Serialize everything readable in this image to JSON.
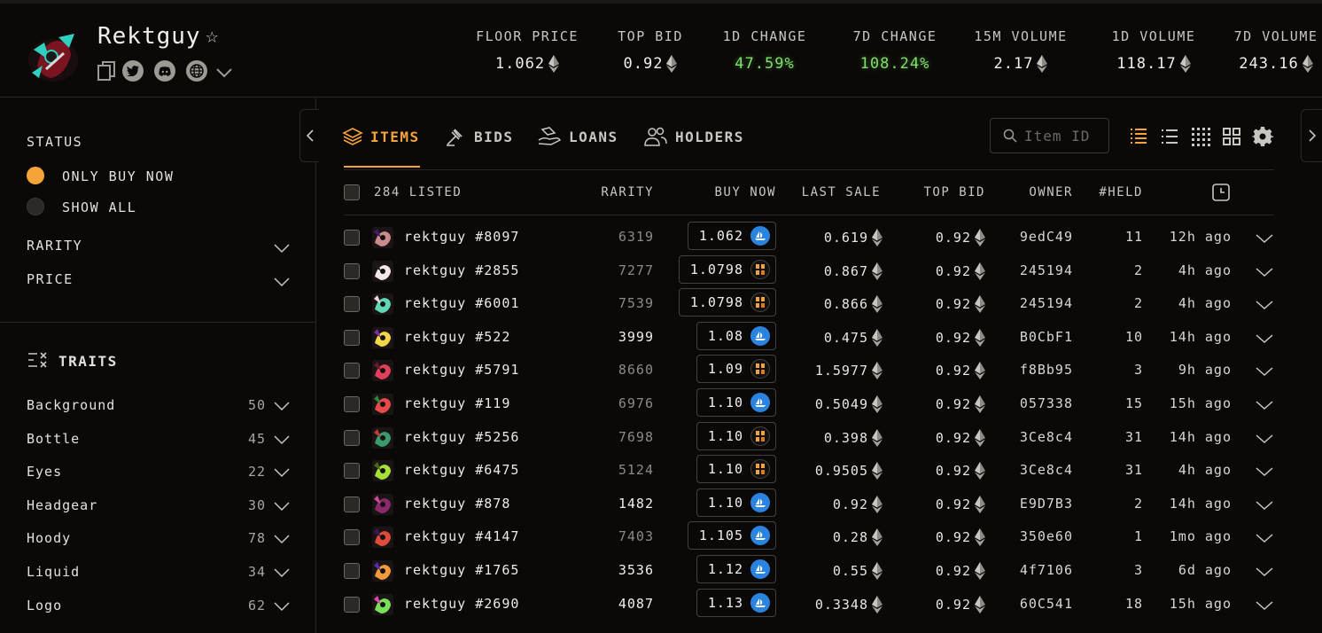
{
  "header": {
    "collection_name": "Rektguy",
    "stats": [
      {
        "label": "FLOOR PRICE",
        "value": "1.062",
        "eth": true,
        "green": false
      },
      {
        "label": "TOP BID",
        "value": "0.92",
        "eth": true,
        "green": false
      },
      {
        "label": "1D CHANGE",
        "value": "47.59%",
        "eth": false,
        "green": true
      },
      {
        "label": "7D CHANGE",
        "value": "108.24%",
        "eth": false,
        "green": true
      },
      {
        "label": "15M VOLUME",
        "value": "2.17",
        "eth": true,
        "green": false
      },
      {
        "label": "1D VOLUME",
        "value": "118.17",
        "eth": true,
        "green": false
      },
      {
        "label": "7D VOLUME",
        "value": "243.16",
        "eth": true,
        "green": false
      }
    ]
  },
  "sidebar": {
    "status_label": "STATUS",
    "only_buy_now": "ONLY BUY NOW",
    "show_all": "SHOW ALL",
    "rarity_label": "RARITY",
    "price_label": "PRICE",
    "traits_label": "TRAITS",
    "traits": [
      {
        "name": "Background",
        "count": "50"
      },
      {
        "name": "Bottle",
        "count": "45"
      },
      {
        "name": "Eyes",
        "count": "22"
      },
      {
        "name": "Headgear",
        "count": "30"
      },
      {
        "name": "Hoody",
        "count": "78"
      },
      {
        "name": "Liquid",
        "count": "34"
      },
      {
        "name": "Logo",
        "count": "62"
      }
    ]
  },
  "tabs": {
    "items": "ITEMS",
    "bids": "BIDS",
    "loans": "LOANS",
    "holders": "HOLDERS"
  },
  "search": {
    "placeholder": "Item ID"
  },
  "table": {
    "headers": {
      "listed": "284 LISTED",
      "rarity": "RARITY",
      "buy_now": "BUY NOW",
      "last_sale": "LAST SALE",
      "top_bid": "TOP BID",
      "owner": "OWNER",
      "held": "#HELD"
    },
    "rows": [
      {
        "name": "rektguy #8097",
        "rarity": "6319",
        "bright": false,
        "buy": "1.062",
        "mkt": "os",
        "last": "0.619",
        "bid": "0.92",
        "owner": "9edC49",
        "held": "11",
        "ago": "12h ago",
        "c1": "#c98b8b",
        "c2": "#3f1f6b"
      },
      {
        "name": "rektguy #2855",
        "rarity": "7277",
        "bright": false,
        "buy": "1.0798",
        "mkt": "bl",
        "last": "0.867",
        "bid": "0.92",
        "owner": "245194",
        "held": "2",
        "ago": "4h ago",
        "c1": "#f2e8ea",
        "c2": "#1a1a1a"
      },
      {
        "name": "rektguy #6001",
        "rarity": "7539",
        "bright": false,
        "buy": "1.0798",
        "mkt": "bl",
        "last": "0.866",
        "bid": "0.92",
        "owner": "245194",
        "held": "2",
        "ago": "4h ago",
        "c1": "#5fd6b6",
        "c2": "#f0d3e0"
      },
      {
        "name": "rektguy #522",
        "rarity": "3999",
        "bright": true,
        "buy": "1.08",
        "mkt": "os",
        "last": "0.475",
        "bid": "0.92",
        "owner": "B0CbF1",
        "held": "10",
        "ago": "14h ago",
        "c1": "#f3d64a",
        "c2": "#7a2ea0"
      },
      {
        "name": "rektguy #5791",
        "rarity": "8660",
        "bright": false,
        "buy": "1.09",
        "mkt": "bl",
        "last": "1.5977",
        "bid": "0.92",
        "owner": "f8Bb95",
        "held": "3",
        "ago": "9h ago",
        "c1": "#e0405a",
        "c2": "#6b1a2a"
      },
      {
        "name": "rektguy #119",
        "rarity": "6976",
        "bright": false,
        "buy": "1.10",
        "mkt": "os",
        "last": "0.5049",
        "bid": "0.92",
        "owner": "057338",
        "held": "15",
        "ago": "15h ago",
        "c1": "#e84a4a",
        "c2": "#2d8a3a"
      },
      {
        "name": "rektguy #5256",
        "rarity": "7698",
        "bright": false,
        "buy": "1.10",
        "mkt": "bl",
        "last": "0.398",
        "bid": "0.92",
        "owner": "3Ce8c4",
        "held": "31",
        "ago": "14h ago",
        "c1": "#3a9a6a",
        "c2": "#c03a3a"
      },
      {
        "name": "rektguy #6475",
        "rarity": "5124",
        "bright": false,
        "buy": "1.10",
        "mkt": "bl",
        "last": "0.9505",
        "bid": "0.92",
        "owner": "3Ce8c4",
        "held": "31",
        "ago": "4h ago",
        "c1": "#a8e03a",
        "c2": "#4a6a1a"
      },
      {
        "name": "rektguy #878",
        "rarity": "1482",
        "bright": true,
        "buy": "1.10",
        "mkt": "os",
        "last": "0.92",
        "bid": "0.92",
        "owner": "E9D7B3",
        "held": "2",
        "ago": "14h ago",
        "c1": "#8a2a6a",
        "c2": "#d04a9a"
      },
      {
        "name": "rektguy #4147",
        "rarity": "7403",
        "bright": false,
        "buy": "1.105",
        "mkt": "os",
        "last": "0.28",
        "bid": "0.92",
        "owner": "350e60",
        "held": "1",
        "ago": "1mo ago",
        "c1": "#e04a3a",
        "c2": "#3a1a5a"
      },
      {
        "name": "rektguy #1765",
        "rarity": "3536",
        "bright": true,
        "buy": "1.12",
        "mkt": "os",
        "last": "0.55",
        "bid": "0.92",
        "owner": "4f7106",
        "held": "3",
        "ago": "6d ago",
        "c1": "#f09a3a",
        "c2": "#5a2ab0"
      },
      {
        "name": "rektguy #2690",
        "rarity": "4087",
        "bright": true,
        "buy": "1.13",
        "mkt": "os",
        "last": "0.3348",
        "bid": "0.92",
        "owner": "60C541",
        "held": "18",
        "ago": "15h ago",
        "c1": "#7ae05a",
        "c2": "#e04ab0"
      }
    ]
  },
  "colors": {
    "accent": "#f5a43a",
    "positive": "#7ee06b",
    "opensea": "#2b83e0",
    "background": "#0b0907"
  }
}
